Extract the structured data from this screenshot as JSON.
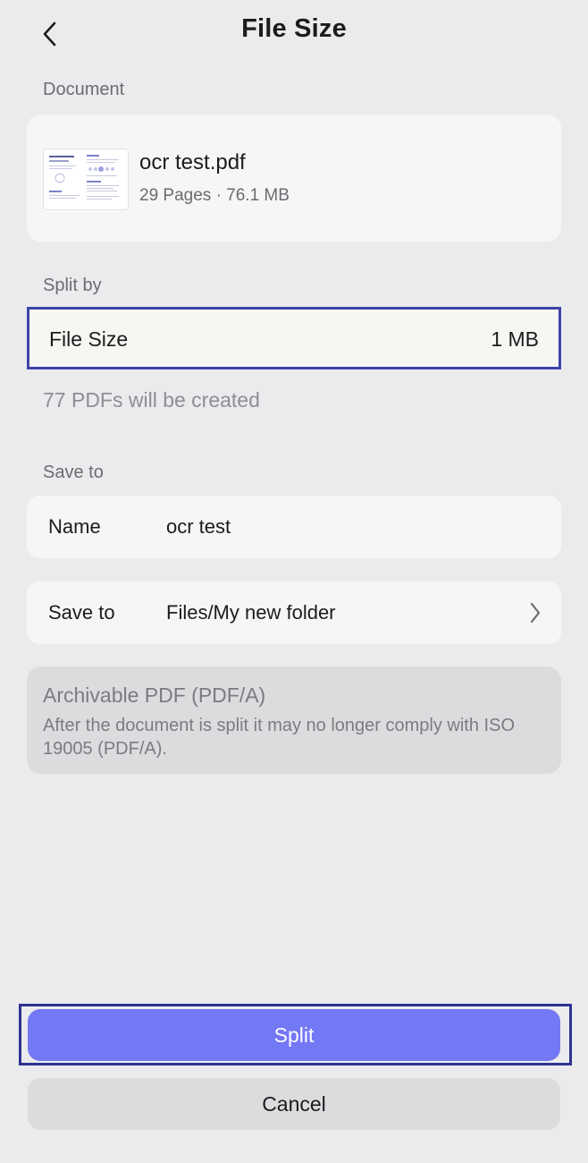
{
  "header": {
    "title": "File Size",
    "back_icon": "chevron-left-icon"
  },
  "document": {
    "section_label": "Document",
    "name": "ocr test.pdf",
    "meta": "29 Pages · 76.1 MB",
    "thumbnail_icon": "pdf-thumbnail"
  },
  "split_by": {
    "section_label": "Split by",
    "label": "File Size",
    "value": "1 MB",
    "note": "77 PDFs will be created"
  },
  "save_to": {
    "section_label": "Save to",
    "name_label": "Name",
    "name_value": "ocr test",
    "location_label": "Save to",
    "location_value": "Files/My new folder",
    "chevron_icon": "chevron-right-icon"
  },
  "archive": {
    "title": "Archivable PDF (PDF/A)",
    "description": "After the document is split it may no longer comply with ISO 19005 (PDF/A)."
  },
  "actions": {
    "split_label": "Split",
    "cancel_label": "Cancel"
  },
  "colors": {
    "background": "#ebebed",
    "accent": "#7378f5",
    "highlight_border": "#3d44a8",
    "muted_text": "#8e8e93"
  }
}
